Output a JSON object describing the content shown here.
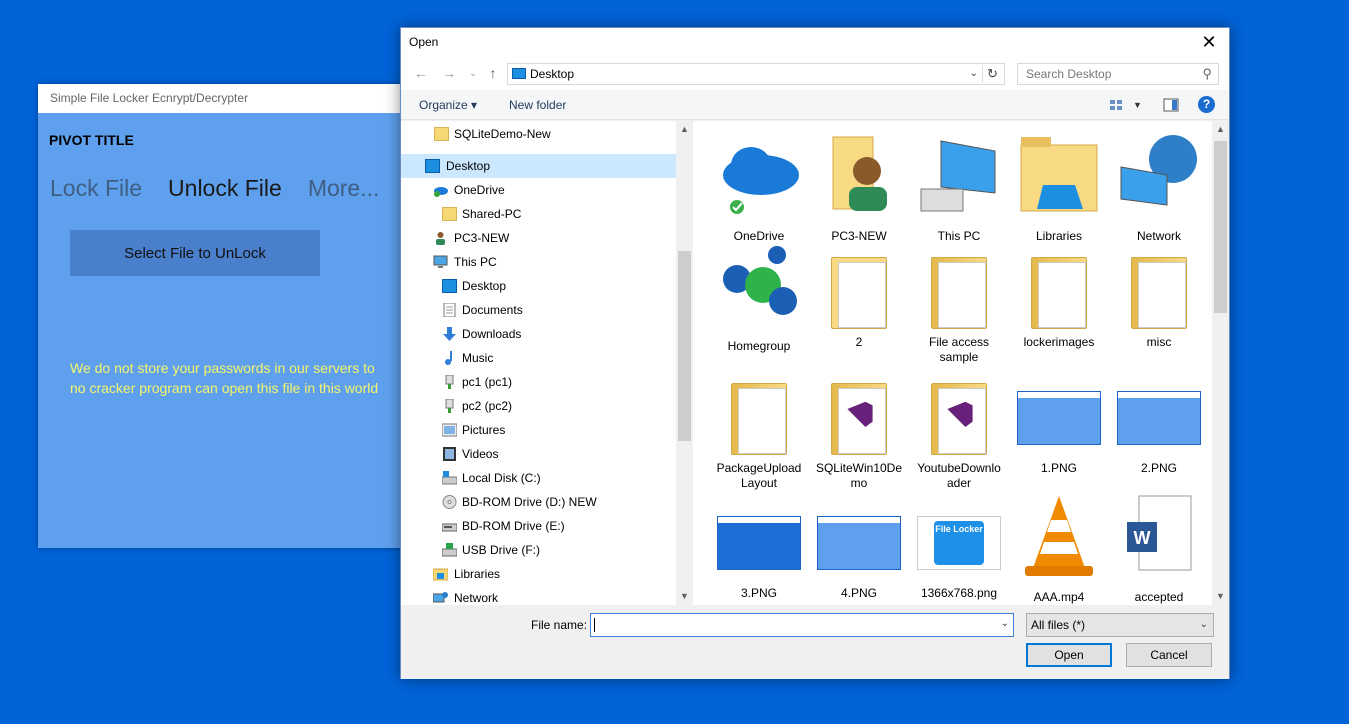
{
  "app": {
    "window_title": "Simple File Locker Ecnrypt/Decrypter",
    "pivot_title": "PIVOT TITLE",
    "tabs": [
      {
        "label": "Lock File"
      },
      {
        "label": "Unlock File"
      },
      {
        "label": "More..."
      }
    ],
    "active_tab": "Unlock File",
    "select_button": "Select File to UnLock",
    "notice_line1": "We do not store your passwords in our servers to",
    "notice_line2": "no cracker program can open this file in this world"
  },
  "dialog": {
    "title": "Open",
    "close_glyph": "✕",
    "address": "Desktop",
    "search_placeholder": "Search Desktop",
    "toolbar": {
      "organize": "Organize ▾",
      "new_folder": "New folder",
      "help": "?"
    },
    "nav": [
      {
        "label": "SQLiteDemo-New",
        "icon": "folder-icon"
      },
      {
        "label": "Desktop",
        "icon": "desktop-icon",
        "selected": true
      },
      {
        "label": "OneDrive",
        "icon": "onedrive-icon"
      },
      {
        "label": "Shared-PC",
        "icon": "shared-folder-icon"
      },
      {
        "label": "PC3-NEW",
        "icon": "user-icon"
      },
      {
        "label": "This PC",
        "icon": "pc-icon"
      },
      {
        "label": "Desktop",
        "icon": "desktop-icon"
      },
      {
        "label": "Documents",
        "icon": "documents-icon"
      },
      {
        "label": "Downloads",
        "icon": "download-icon"
      },
      {
        "label": "Music",
        "icon": "music-icon"
      },
      {
        "label": "pc1 (pc1)",
        "icon": "network-drive-icon"
      },
      {
        "label": "pc2 (pc2)",
        "icon": "network-drive-icon"
      },
      {
        "label": "Pictures",
        "icon": "pictures-icon"
      },
      {
        "label": "Videos",
        "icon": "videos-icon"
      },
      {
        "label": "Local Disk (C:)",
        "icon": "disk-icon"
      },
      {
        "label": "BD-ROM Drive (D:) NEW",
        "icon": "disc-icon"
      },
      {
        "label": "BD-ROM Drive (E:)",
        "icon": "bd-drive-icon"
      },
      {
        "label": "USB Drive (F:)",
        "icon": "usb-drive-icon"
      },
      {
        "label": "Libraries",
        "icon": "libraries-icon"
      },
      {
        "label": "Network",
        "icon": "network-icon"
      }
    ],
    "files": [
      {
        "label": "OneDrive",
        "icon": "onedrive-icon"
      },
      {
        "label": "PC3-NEW",
        "icon": "user-folder-icon"
      },
      {
        "label": "This PC",
        "icon": "pc-icon"
      },
      {
        "label": "Libraries",
        "icon": "libraries-icon"
      },
      {
        "label": "Network",
        "icon": "network-icon"
      },
      {
        "label": "Homegroup",
        "icon": "homegroup-icon"
      },
      {
        "label": "2",
        "icon": "folder-icon"
      },
      {
        "label": "File access\nsample",
        "icon": "folder-icon"
      },
      {
        "label": "lockerimages",
        "icon": "folder-icon"
      },
      {
        "label": "misc",
        "icon": "folder-icon"
      },
      {
        "label": "PackageUpload\nLayout",
        "icon": "folder-icon"
      },
      {
        "label": "SQLiteWin10De\nmo",
        "icon": "vs-folder-icon"
      },
      {
        "label": "YoutubeDownlo\nader",
        "icon": "vs-folder-icon"
      },
      {
        "label": "1.PNG",
        "icon": "image-icon"
      },
      {
        "label": "2.PNG",
        "icon": "image-icon"
      },
      {
        "label": "3.PNG",
        "icon": "image-icon"
      },
      {
        "label": "4.PNG",
        "icon": "image-icon"
      },
      {
        "label": "1366x768.png",
        "icon": "image-icon"
      },
      {
        "label": "AAA.mp4",
        "icon": "vlc-icon"
      },
      {
        "label": "accepted\nduas.docx",
        "icon": "word-doc-icon"
      }
    ],
    "thumb_text": "File Locker",
    "filename_label": "File name:",
    "filename_value": "",
    "filter": "All files (*)",
    "open_button": "Open",
    "cancel_button": "Cancel",
    "colors": {
      "accent": "#0078d7",
      "selected": "#cce8ff",
      "desktop_bg": "#0063d8",
      "app_bg": "#5fa0ee"
    }
  }
}
